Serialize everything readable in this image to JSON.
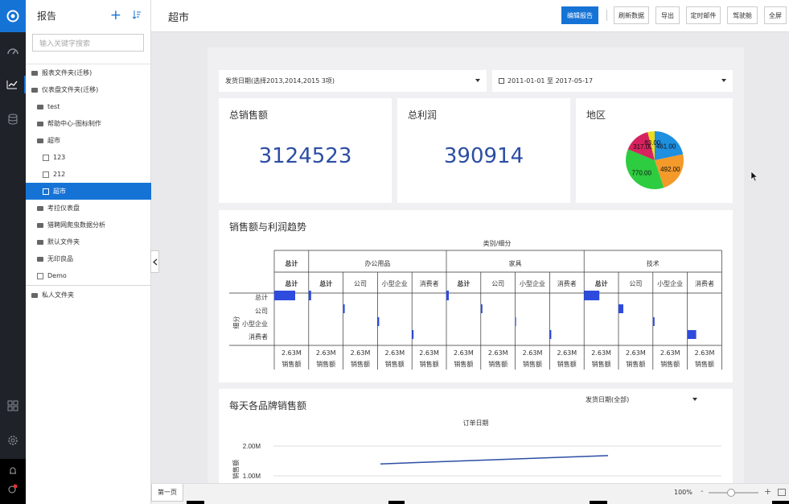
{
  "sidebar": {
    "title": "报告",
    "search_placeholder": "输入关键字搜索",
    "tree": [
      {
        "label": "报表文件夹(迁移)",
        "kind": "folder",
        "level": 0
      },
      {
        "label": "仪表盘文件夹(迁移)",
        "kind": "folder",
        "level": 0
      },
      {
        "label": "test",
        "kind": "folder",
        "level": 1
      },
      {
        "label": "帮助中心-图标制作",
        "kind": "folder",
        "level": 1
      },
      {
        "label": "超市",
        "kind": "folder",
        "level": 1
      },
      {
        "label": "123",
        "kind": "chart",
        "level": 2
      },
      {
        "label": "212",
        "kind": "chart",
        "level": 2
      },
      {
        "label": "超市",
        "kind": "chart",
        "level": 2,
        "selected": true
      },
      {
        "label": "考拉仪表盘",
        "kind": "folder",
        "level": 1
      },
      {
        "label": "猎聘网爬虫数据分析",
        "kind": "folder",
        "level": 1
      },
      {
        "label": "默认文件夹",
        "kind": "folder",
        "level": 1
      },
      {
        "label": "无印良品",
        "kind": "folder",
        "level": 1
      },
      {
        "label": "Demo",
        "kind": "chart",
        "level": 1
      },
      {
        "label": "私人文件夹",
        "kind": "folder",
        "level": 0,
        "separator_before": true
      }
    ]
  },
  "topbar": {
    "title": "超市",
    "buttons": {
      "edit": "编辑报告",
      "refresh": "刷新数据",
      "export": "导出",
      "schedule": "定时邮件",
      "cockpit": "驾驶舱",
      "fullscreen": "全屏"
    }
  },
  "filters": {
    "ship_date": "发货日期(选择2013,2014,2015 3项)",
    "date_range": "2011-01-01 至 2017-05-17"
  },
  "kpis": {
    "sales_title": "总销售额",
    "sales_value": "3124523",
    "profit_title": "总利润",
    "profit_value": "390914"
  },
  "region_card": {
    "title": "地区"
  },
  "matrix": {
    "title": "销售额与利润趋势",
    "top_header": "类别/细分",
    "groups": [
      {
        "name": "办公用品",
        "cols": [
          "总计",
          "公司",
          "小型企业",
          "消费者"
        ]
      },
      {
        "name": "家具",
        "cols": [
          "总计",
          "公司",
          "小型企业",
          "消费者"
        ]
      },
      {
        "name": "技术",
        "cols": [
          "总计",
          "公司",
          "小型企业",
          "消费者"
        ]
      }
    ],
    "grand_total": "总计",
    "row_dim": "细分",
    "rows": [
      "总计",
      "公司",
      "小型企业",
      "消费者"
    ],
    "footer_value": "2.63M",
    "footer_label": "销售额"
  },
  "brand_card": {
    "title": "每天各品牌销售额",
    "filter": "发货日期(全部)",
    "x_title": "订单日期",
    "y_title": "销售额"
  },
  "footer": {
    "page_tab": "第一页",
    "zoom": "100%",
    "minus": "-",
    "plus": "+"
  },
  "colors": {
    "brand": "#1673d6",
    "kpi": "#2c4ea3",
    "bar": "#2d4bdc"
  },
  "chart_data": [
    {
      "type": "pie",
      "title": "",
      "labels": [
        "461.00",
        "492.00",
        "770.00",
        "317.00",
        "83.00"
      ],
      "values": [
        461,
        492,
        770,
        317,
        83
      ],
      "colors": [
        "#1f8fe0",
        "#f39a2a",
        "#2ecc40",
        "#d6235f",
        "#eddc1c"
      ]
    },
    {
      "type": "line",
      "title": "",
      "xlabel": "订单日期",
      "ylabel": "销售额",
      "y_ticks": [
        "2.00M",
        "1.00M"
      ],
      "series": [
        {
          "values": [
            1.4,
            1.68
          ]
        }
      ]
    }
  ]
}
